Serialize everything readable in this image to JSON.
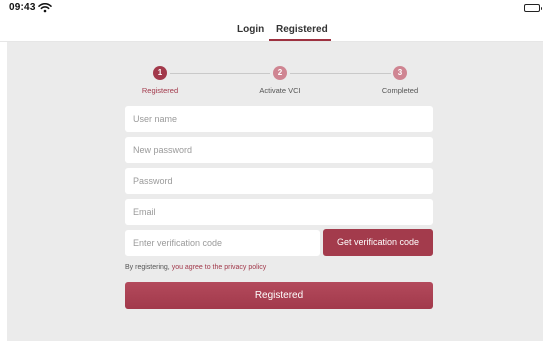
{
  "status_bar": {
    "time": "09:43"
  },
  "tabs": {
    "login": "Login",
    "registered": "Registered"
  },
  "stepper": {
    "steps": [
      {
        "number": "1",
        "label": "Registered"
      },
      {
        "number": "2",
        "label": "Activate VCI"
      },
      {
        "number": "3",
        "label": "Completed"
      }
    ],
    "active_index": 0
  },
  "form": {
    "username_placeholder": "User name",
    "new_password_placeholder": "New password",
    "password_placeholder": "Password",
    "email_placeholder": "Email",
    "verification_placeholder": "Enter verification code",
    "get_code_label": "Get verification code",
    "agree_prefix": "By registering, ",
    "agree_link": "you agree to the privacy policy",
    "submit_label": "Registered"
  },
  "colors": {
    "accent": "#a2394b",
    "accent_light": "#cf8592",
    "background": "#ebebeb"
  },
  "icons": [
    "wifi-icon",
    "battery-icon"
  ]
}
